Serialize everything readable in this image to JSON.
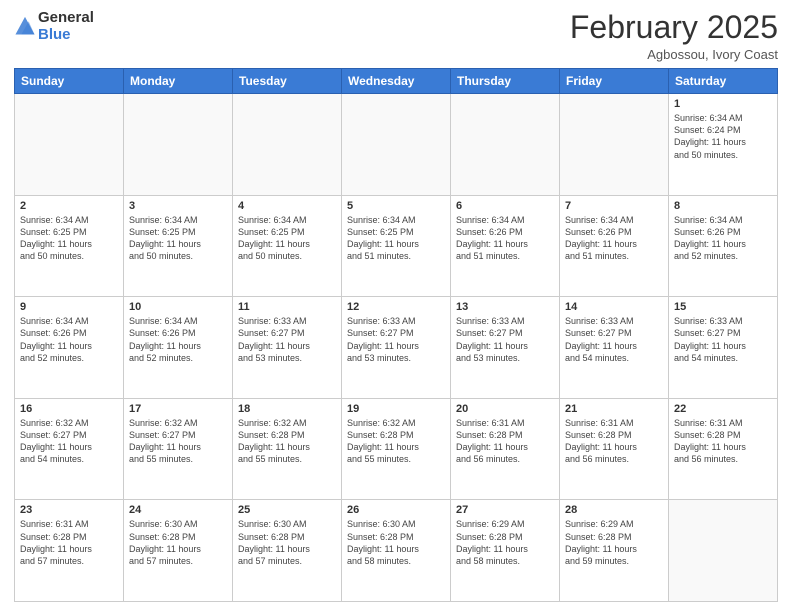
{
  "header": {
    "logo_general": "General",
    "logo_blue": "Blue",
    "month": "February 2025",
    "location": "Agbossou, Ivory Coast"
  },
  "weekdays": [
    "Sunday",
    "Monday",
    "Tuesday",
    "Wednesday",
    "Thursday",
    "Friday",
    "Saturday"
  ],
  "weeks": [
    [
      {
        "day": "",
        "info": ""
      },
      {
        "day": "",
        "info": ""
      },
      {
        "day": "",
        "info": ""
      },
      {
        "day": "",
        "info": ""
      },
      {
        "day": "",
        "info": ""
      },
      {
        "day": "",
        "info": ""
      },
      {
        "day": "1",
        "info": "Sunrise: 6:34 AM\nSunset: 6:24 PM\nDaylight: 11 hours\nand 50 minutes."
      }
    ],
    [
      {
        "day": "2",
        "info": "Sunrise: 6:34 AM\nSunset: 6:25 PM\nDaylight: 11 hours\nand 50 minutes."
      },
      {
        "day": "3",
        "info": "Sunrise: 6:34 AM\nSunset: 6:25 PM\nDaylight: 11 hours\nand 50 minutes."
      },
      {
        "day": "4",
        "info": "Sunrise: 6:34 AM\nSunset: 6:25 PM\nDaylight: 11 hours\nand 50 minutes."
      },
      {
        "day": "5",
        "info": "Sunrise: 6:34 AM\nSunset: 6:25 PM\nDaylight: 11 hours\nand 51 minutes."
      },
      {
        "day": "6",
        "info": "Sunrise: 6:34 AM\nSunset: 6:26 PM\nDaylight: 11 hours\nand 51 minutes."
      },
      {
        "day": "7",
        "info": "Sunrise: 6:34 AM\nSunset: 6:26 PM\nDaylight: 11 hours\nand 51 minutes."
      },
      {
        "day": "8",
        "info": "Sunrise: 6:34 AM\nSunset: 6:26 PM\nDaylight: 11 hours\nand 52 minutes."
      }
    ],
    [
      {
        "day": "9",
        "info": "Sunrise: 6:34 AM\nSunset: 6:26 PM\nDaylight: 11 hours\nand 52 minutes."
      },
      {
        "day": "10",
        "info": "Sunrise: 6:34 AM\nSunset: 6:26 PM\nDaylight: 11 hours\nand 52 minutes."
      },
      {
        "day": "11",
        "info": "Sunrise: 6:33 AM\nSunset: 6:27 PM\nDaylight: 11 hours\nand 53 minutes."
      },
      {
        "day": "12",
        "info": "Sunrise: 6:33 AM\nSunset: 6:27 PM\nDaylight: 11 hours\nand 53 minutes."
      },
      {
        "day": "13",
        "info": "Sunrise: 6:33 AM\nSunset: 6:27 PM\nDaylight: 11 hours\nand 53 minutes."
      },
      {
        "day": "14",
        "info": "Sunrise: 6:33 AM\nSunset: 6:27 PM\nDaylight: 11 hours\nand 54 minutes."
      },
      {
        "day": "15",
        "info": "Sunrise: 6:33 AM\nSunset: 6:27 PM\nDaylight: 11 hours\nand 54 minutes."
      }
    ],
    [
      {
        "day": "16",
        "info": "Sunrise: 6:32 AM\nSunset: 6:27 PM\nDaylight: 11 hours\nand 54 minutes."
      },
      {
        "day": "17",
        "info": "Sunrise: 6:32 AM\nSunset: 6:27 PM\nDaylight: 11 hours\nand 55 minutes."
      },
      {
        "day": "18",
        "info": "Sunrise: 6:32 AM\nSunset: 6:28 PM\nDaylight: 11 hours\nand 55 minutes."
      },
      {
        "day": "19",
        "info": "Sunrise: 6:32 AM\nSunset: 6:28 PM\nDaylight: 11 hours\nand 55 minutes."
      },
      {
        "day": "20",
        "info": "Sunrise: 6:31 AM\nSunset: 6:28 PM\nDaylight: 11 hours\nand 56 minutes."
      },
      {
        "day": "21",
        "info": "Sunrise: 6:31 AM\nSunset: 6:28 PM\nDaylight: 11 hours\nand 56 minutes."
      },
      {
        "day": "22",
        "info": "Sunrise: 6:31 AM\nSunset: 6:28 PM\nDaylight: 11 hours\nand 56 minutes."
      }
    ],
    [
      {
        "day": "23",
        "info": "Sunrise: 6:31 AM\nSunset: 6:28 PM\nDaylight: 11 hours\nand 57 minutes."
      },
      {
        "day": "24",
        "info": "Sunrise: 6:30 AM\nSunset: 6:28 PM\nDaylight: 11 hours\nand 57 minutes."
      },
      {
        "day": "25",
        "info": "Sunrise: 6:30 AM\nSunset: 6:28 PM\nDaylight: 11 hours\nand 57 minutes."
      },
      {
        "day": "26",
        "info": "Sunrise: 6:30 AM\nSunset: 6:28 PM\nDaylight: 11 hours\nand 58 minutes."
      },
      {
        "day": "27",
        "info": "Sunrise: 6:29 AM\nSunset: 6:28 PM\nDaylight: 11 hours\nand 58 minutes."
      },
      {
        "day": "28",
        "info": "Sunrise: 6:29 AM\nSunset: 6:28 PM\nDaylight: 11 hours\nand 59 minutes."
      },
      {
        "day": "",
        "info": ""
      }
    ]
  ]
}
